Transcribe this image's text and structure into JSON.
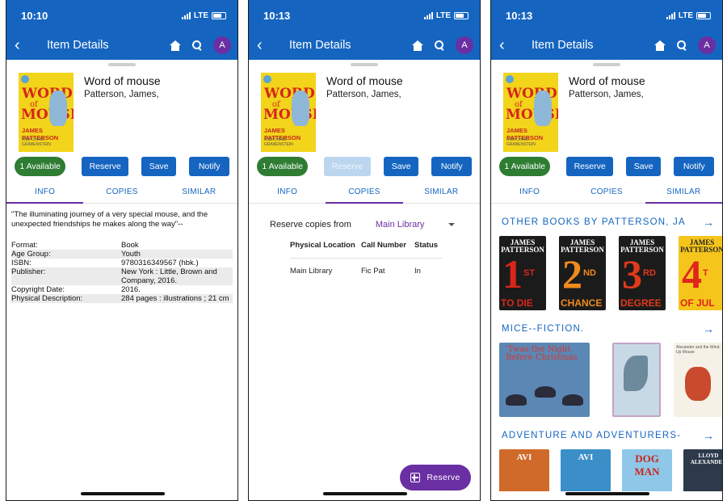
{
  "status": {
    "times": [
      "10:10",
      "10:13",
      "10:13"
    ],
    "network": "LTE"
  },
  "appbar": {
    "back": "‹",
    "title": "Item Details",
    "avatar": "A"
  },
  "book": {
    "title": "Word of mouse",
    "author": "Patterson, James,",
    "cover_text": {
      "title_top": "WORD",
      "title_mid": "of",
      "title_bottom": "MOUSE",
      "author": "JAMES PATTERSON",
      "coauthor": "AND CHRIS GRABENSTEIN"
    }
  },
  "actions": {
    "available": "1 Available",
    "reserve": "Reserve",
    "save": "Save",
    "notify": "Notify"
  },
  "tabs": [
    "INFO",
    "COPIES",
    "SIMILAR"
  ],
  "info": {
    "summary": "\"The illuminating journey of a very special mouse, and the unexpected friendships he makes along the way\"--",
    "rows": [
      {
        "k": "Format:",
        "v": "Book"
      },
      {
        "k": "Age Group:",
        "v": "Youth"
      },
      {
        "k": "ISBN:",
        "v": "9780316349567 (hbk.)"
      },
      {
        "k": "Publisher:",
        "v": "New York : Little, Brown and Company, 2016."
      },
      {
        "k": "Copyright Date:",
        "v": "2016."
      },
      {
        "k": "Physical Description:",
        "v": "284 pages : illustrations ; 21 cm"
      }
    ]
  },
  "copies": {
    "reserve_from_label": "Reserve copies from",
    "library": "Main Library",
    "headers": [
      "Physical Location",
      "Call Number",
      "Status"
    ],
    "rows": [
      {
        "location": "Main Library",
        "call_number": "Fic Pat",
        "status": "In"
      }
    ],
    "fab": "Reserve"
  },
  "similar": {
    "sections": [
      {
        "heading": "OTHER BOOKS BY PATTERSON, JA",
        "covers": [
          {
            "author": "JAMES PATTERSON",
            "number": "1",
            "suffix": "ST",
            "subtitle": "TO DIE"
          },
          {
            "author": "JAMES PATTERSON",
            "number": "2",
            "suffix": "ND",
            "subtitle": "CHANCE"
          },
          {
            "author": "JAMES PATTERSON",
            "number": "3",
            "suffix": "RD",
            "subtitle": "DEGREE"
          },
          {
            "author": "JAMES PATTERSON",
            "number": "4",
            "suffix": "T",
            "subtitle": "OF JUL"
          }
        ]
      },
      {
        "heading": "MICE--FICTION.",
        "covers": [
          {
            "text": "'Twas the Night Before Christmas"
          },
          {
            "text": ""
          },
          {
            "text": "Alexander and the Wind-Up Mouse"
          }
        ]
      },
      {
        "heading": "ADVENTURE AND ADVENTURERS-",
        "covers": [
          {
            "text": "AVI"
          },
          {
            "text": "AVI"
          },
          {
            "text": "DOG MAN"
          },
          {
            "text": "LLOYD ALEXANDER"
          }
        ]
      }
    ],
    "arrow": "→"
  },
  "colors": {
    "primary": "#1565c0",
    "accent": "#6a2fa3",
    "available": "#2e7d32"
  }
}
